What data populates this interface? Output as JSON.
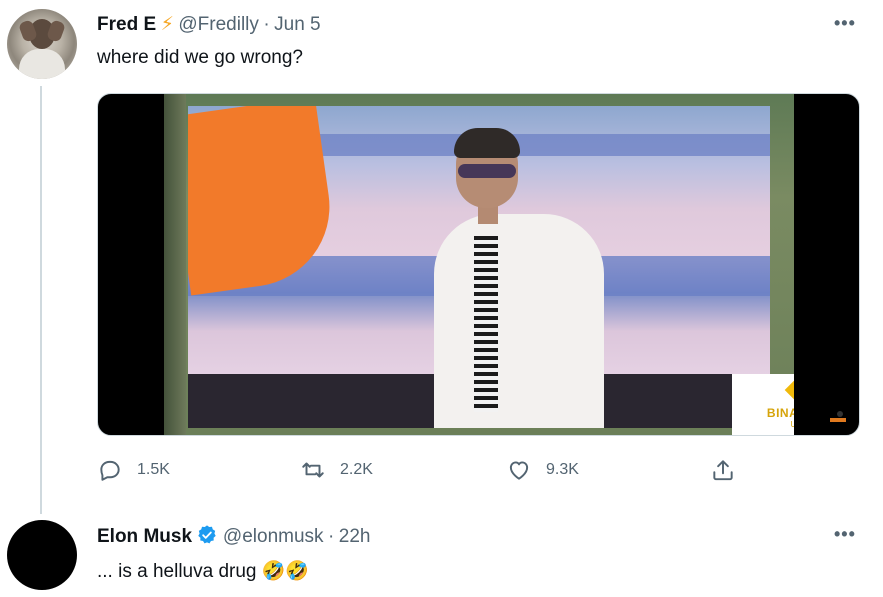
{
  "tweet1": {
    "name": "Fred E",
    "name_emoji": "⚡",
    "handle": "@Fredilly",
    "separator": "·",
    "time": "Jun 5",
    "text": "where did we go wrong?",
    "more": "•••",
    "media": {
      "watermark_line1": "BINANCE",
      "watermark_line2": "US"
    },
    "actions": {
      "replies": "1.5K",
      "retweets": "2.2K",
      "likes": "9.3K"
    }
  },
  "tweet2": {
    "name": "Elon Musk",
    "handle": "@elonmusk",
    "separator": "·",
    "time": "22h",
    "text": "... is a helluva drug",
    "emoji": "🤣🤣",
    "more": "•••"
  },
  "colors": {
    "verified": "#1d9bf0",
    "secondary_text": "#536471",
    "thread_line": "#cfd9de"
  },
  "icons": [
    "reply-icon",
    "retweet-icon",
    "like-icon",
    "share-icon",
    "more-icon",
    "verified-icon"
  ]
}
